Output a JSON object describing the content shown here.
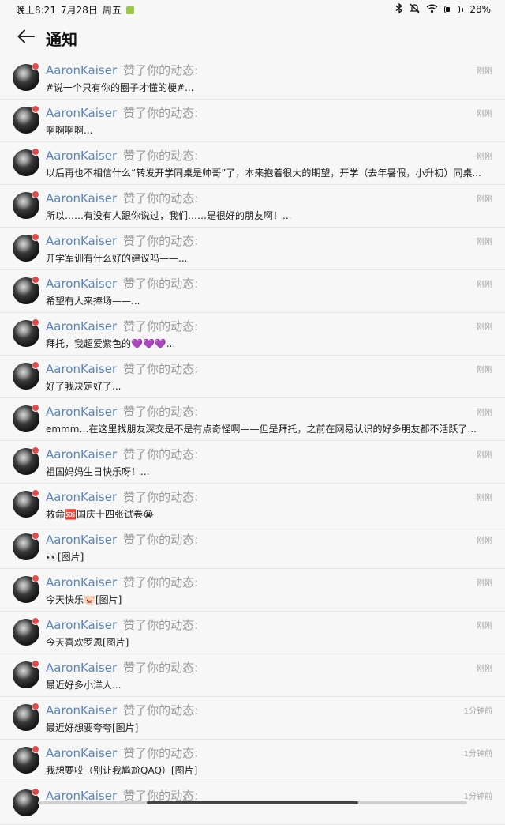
{
  "status_bar": {
    "time": "晚上8:21",
    "date": "7月28日",
    "weekday": "周五",
    "battery": "28%",
    "battery_level": 0.28,
    "icons": [
      "app-notification-icon",
      "bluetooth-icon",
      "mute-icon",
      "wifi-icon",
      "battery-icon"
    ]
  },
  "header": {
    "title": "通知",
    "back_icon": "back-arrow-icon"
  },
  "notifications": [
    {
      "user": "AaronKaiser",
      "action": "赞了你的动态:",
      "time": "刚刚",
      "content": "#说一个只有你的圈子才懂的梗#..."
    },
    {
      "user": "AaronKaiser",
      "action": "赞了你的动态:",
      "time": "刚刚",
      "content": "啊啊啊啊..."
    },
    {
      "user": "AaronKaiser",
      "action": "赞了你的动态:",
      "time": "刚刚",
      "content": "以后再也不相信什么“转发开学同桌是帅哥”了，本来抱着很大的期望，开学（去年暑假，小升初）同桌..."
    },
    {
      "user": "AaronKaiser",
      "action": "赞了你的动态:",
      "time": "刚刚",
      "content": "所以……有没有人跟你说过，我们……是很好的朋友啊！..."
    },
    {
      "user": "AaronKaiser",
      "action": "赞了你的动态:",
      "time": "刚刚",
      "content": "开学军训有什么好的建议吗——..."
    },
    {
      "user": "AaronKaiser",
      "action": "赞了你的动态:",
      "time": "刚刚",
      "content": "希望有人来捧场——..."
    },
    {
      "user": "AaronKaiser",
      "action": "赞了你的动态:",
      "time": "刚刚",
      "content": "拜托，我超爱紫色的💜💜💜..."
    },
    {
      "user": "AaronKaiser",
      "action": "赞了你的动态:",
      "time": "刚刚",
      "content": "好了我决定好了..."
    },
    {
      "user": "AaronKaiser",
      "action": "赞了你的动态:",
      "time": "刚刚",
      "content": "emmm…在这里找朋友深交是不是有点奇怪啊——但是拜托，之前在网易认识的好多朋友都不活跃了..."
    },
    {
      "user": "AaronKaiser",
      "action": "赞了你的动态:",
      "time": "刚刚",
      "content": "祖国妈妈生日快乐呀！..."
    },
    {
      "user": "AaronKaiser",
      "action": "赞了你的动态:",
      "time": "刚刚",
      "content": "救命🆘国庆十四张试卷😭"
    },
    {
      "user": "AaronKaiser",
      "action": "赞了你的动态:",
      "time": "刚刚",
      "content": "👀[图片]"
    },
    {
      "user": "AaronKaiser",
      "action": "赞了你的动态:",
      "time": "刚刚",
      "content": "今天快乐🐷[图片]"
    },
    {
      "user": "AaronKaiser",
      "action": "赞了你的动态:",
      "time": "刚刚",
      "content": "今天喜欢罗恩[图片]"
    },
    {
      "user": "AaronKaiser",
      "action": "赞了你的动态:",
      "time": "刚刚",
      "content": "最近好多小洋人..."
    },
    {
      "user": "AaronKaiser",
      "action": "赞了你的动态:",
      "time": "1分钟前",
      "content": "最近好想要夸夸[图片]"
    },
    {
      "user": "AaronKaiser",
      "action": "赞了你的动态:",
      "time": "1分钟前",
      "content": "我想要哎（别让我尴尬QAQ）[图片]"
    },
    {
      "user": "AaronKaiser",
      "action": "赞了你的动态:",
      "time": "1分钟前",
      "content": ""
    }
  ],
  "colors": {
    "background": "#f7f7f7",
    "username": "#5b86b8",
    "action": "#9a9a9a",
    "time": "#a6a6a6",
    "unread_dot": "#e24b4b"
  }
}
